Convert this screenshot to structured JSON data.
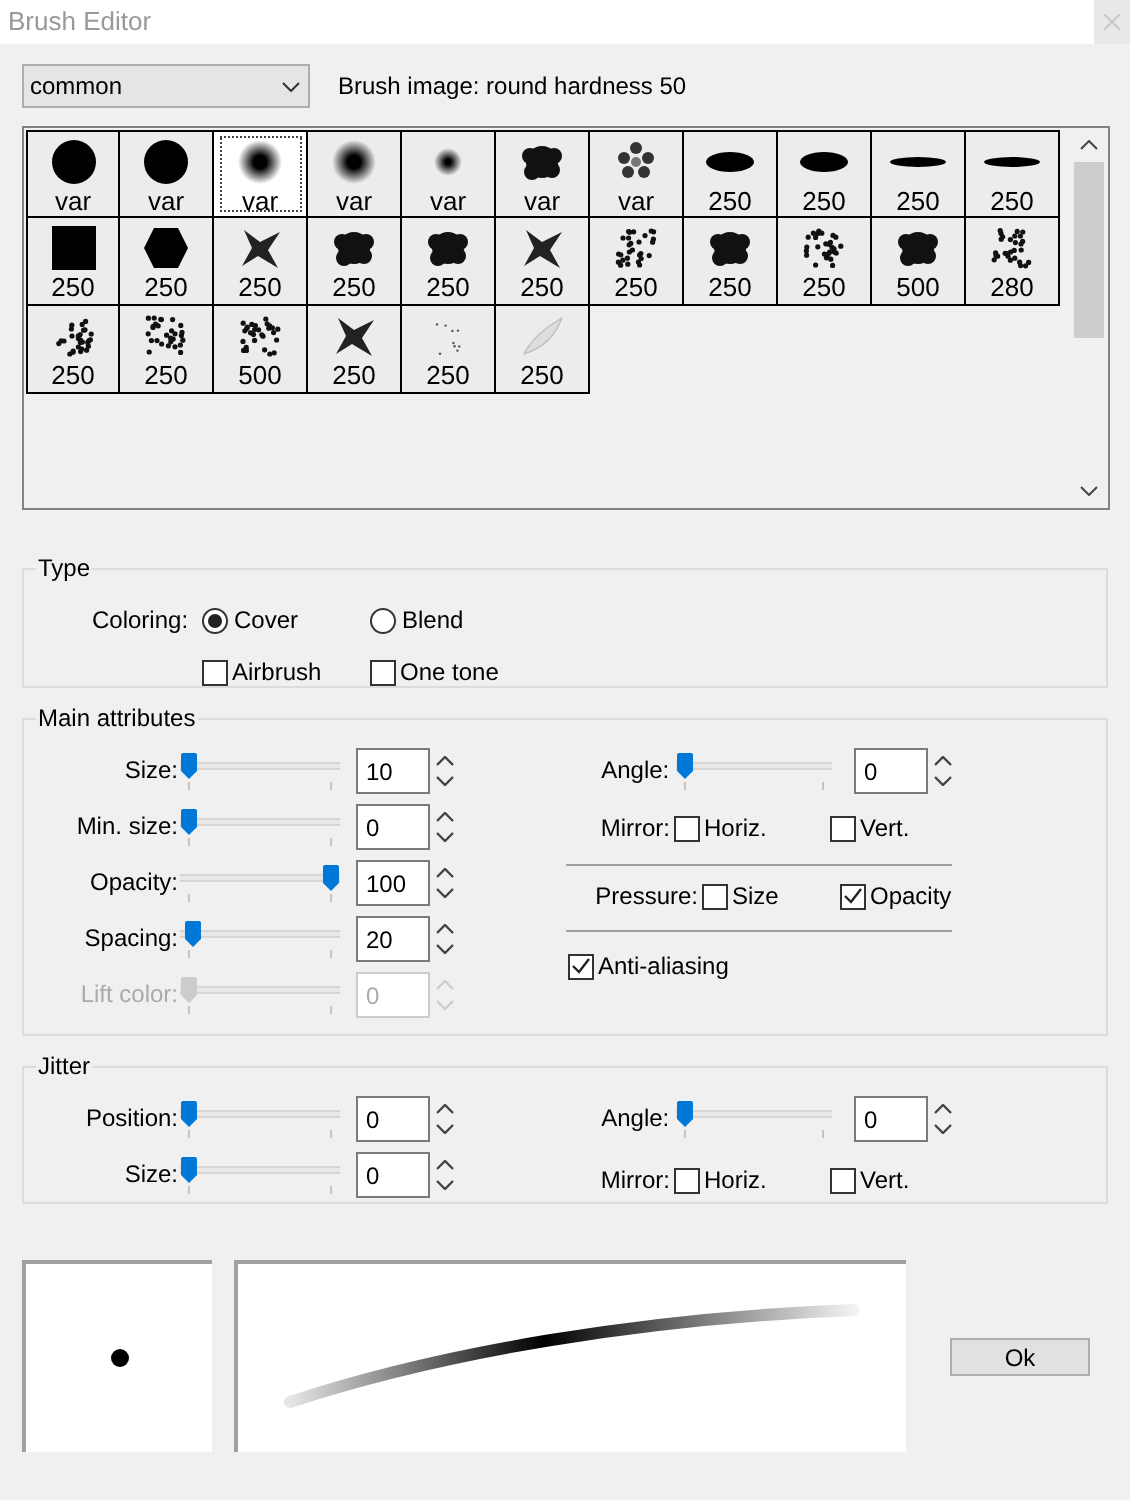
{
  "window": {
    "title": "Brush Editor"
  },
  "brush_set": {
    "value": "common"
  },
  "brush_image_label": "Brush image: round hardness 50",
  "brushes": [
    {
      "kind": "circle",
      "size": "var",
      "selected": false
    },
    {
      "kind": "circle",
      "size": "var",
      "selected": false
    },
    {
      "kind": "soft",
      "size": "var",
      "selected": true
    },
    {
      "kind": "soft",
      "size": "var",
      "selected": false
    },
    {
      "kind": "soft-small",
      "size": "var",
      "selected": false
    },
    {
      "kind": "blot",
      "size": "var",
      "selected": false
    },
    {
      "kind": "flower",
      "size": "var",
      "selected": false
    },
    {
      "kind": "ellipse",
      "size": "250",
      "selected": false
    },
    {
      "kind": "ellipse",
      "size": "250",
      "selected": false
    },
    {
      "kind": "line",
      "size": "250",
      "selected": false
    },
    {
      "kind": "line",
      "size": "250",
      "selected": false
    },
    {
      "kind": "square",
      "size": "250",
      "selected": false
    },
    {
      "kind": "hexagon",
      "size": "250",
      "selected": false
    },
    {
      "kind": "star",
      "size": "250",
      "selected": false
    },
    {
      "kind": "blot",
      "size": "250",
      "selected": false
    },
    {
      "kind": "blot",
      "size": "250",
      "selected": false
    },
    {
      "kind": "star",
      "size": "250",
      "selected": false
    },
    {
      "kind": "speckle",
      "size": "250",
      "selected": false
    },
    {
      "kind": "blot",
      "size": "250",
      "selected": false
    },
    {
      "kind": "speckle",
      "size": "250",
      "selected": false
    },
    {
      "kind": "blot",
      "size": "500",
      "selected": false
    },
    {
      "kind": "speckle",
      "size": "280",
      "selected": false
    },
    {
      "kind": "speckle",
      "size": "250",
      "selected": false
    },
    {
      "kind": "speckle",
      "size": "250",
      "selected": false
    },
    {
      "kind": "speckle",
      "size": "500",
      "selected": false
    },
    {
      "kind": "star",
      "size": "250",
      "selected": false
    },
    {
      "kind": "dots",
      "size": "250",
      "selected": false
    },
    {
      "kind": "feather",
      "size": "250",
      "selected": false
    }
  ],
  "type": {
    "title": "Type",
    "coloring_label": "Coloring:",
    "radios": [
      {
        "label": "Cover",
        "selected": true
      },
      {
        "label": "Blend",
        "selected": false
      }
    ],
    "checkboxes": [
      {
        "label": "Airbrush",
        "checked": false
      },
      {
        "label": "One tone",
        "checked": false
      }
    ]
  },
  "main": {
    "title": "Main attributes",
    "sliders": [
      {
        "label": "Size:",
        "value": "10",
        "level": 0.0,
        "disabled": false
      },
      {
        "label": "Min. size:",
        "value": "0",
        "level": 0.0,
        "disabled": false
      },
      {
        "label": "Opacity:",
        "value": "100",
        "level": 1.0,
        "disabled": false
      },
      {
        "label": "Spacing:",
        "value": "20",
        "level": 0.03,
        "disabled": false
      },
      {
        "label": "Lift color:",
        "value": "0",
        "level": 0.0,
        "disabled": true
      }
    ],
    "angle": {
      "label": "Angle:",
      "value": "0",
      "level": 0.0
    },
    "mirror": {
      "label": "Mirror:",
      "options": [
        {
          "label": "Horiz.",
          "checked": false
        },
        {
          "label": "Vert.",
          "checked": false
        }
      ]
    },
    "pressure": {
      "label": "Pressure:",
      "options": [
        {
          "label": "Size",
          "checked": false
        },
        {
          "label": "Opacity",
          "checked": true
        }
      ]
    },
    "anti_aliasing": {
      "label": "Anti-aliasing",
      "checked": true
    }
  },
  "jitter": {
    "title": "Jitter",
    "sliders": [
      {
        "label": "Position:",
        "value": "0",
        "level": 0.0,
        "disabled": false
      },
      {
        "label": "Size:",
        "value": "0",
        "level": 0.0,
        "disabled": false
      }
    ],
    "angle": {
      "label": "Angle:",
      "value": "0",
      "level": 0.0
    },
    "mirror": {
      "label": "Mirror:",
      "options": [
        {
          "label": "Horiz.",
          "checked": false
        },
        {
          "label": "Vert.",
          "checked": false
        }
      ]
    }
  },
  "ok_button": "Ok"
}
